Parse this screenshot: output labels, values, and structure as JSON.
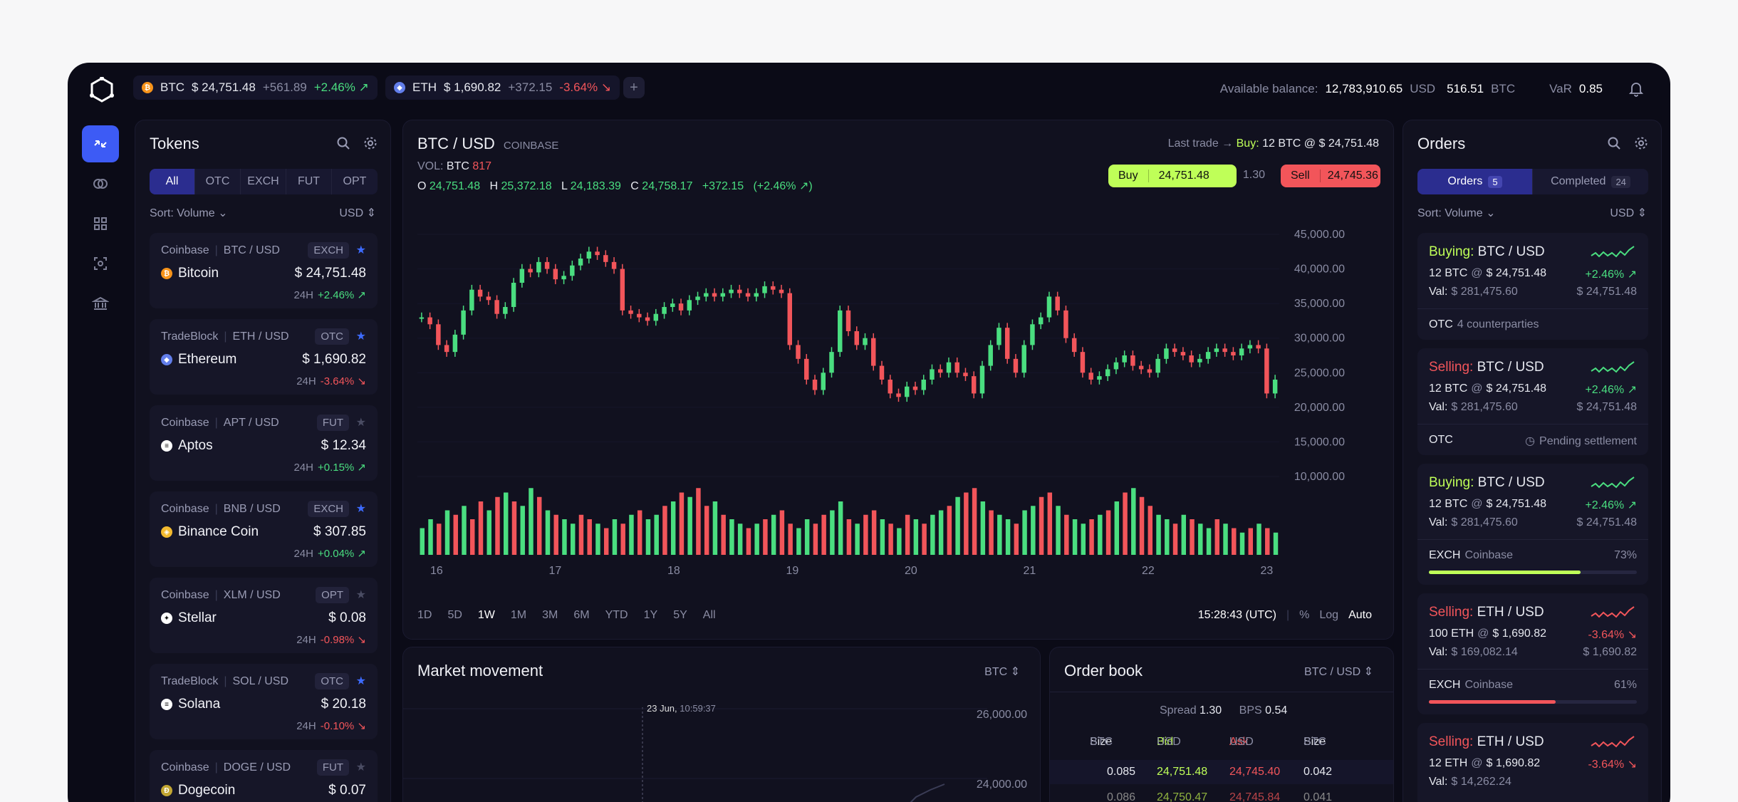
{
  "topbar": {
    "tickers": [
      {
        "symbol": "BTC",
        "price": "$ 24,751.48",
        "change_abs": "+561.89",
        "change_pct": "+2.46% ↗",
        "dir": "pos",
        "coin_color": "#f7931a"
      },
      {
        "symbol": "ETH",
        "price": "$ 1,690.82",
        "change_abs": "+372.15",
        "change_pct": "-3.64% ↘",
        "dir": "neg",
        "coin_color": "#627eea"
      }
    ],
    "add_tab": "+",
    "balance_label": "Available balance:",
    "balance_usd": "12,783,910.65",
    "balance_usd_unit": "USD",
    "balance_btc": "516.51",
    "balance_btc_unit": "BTC",
    "var_label": "VaR",
    "var_value": "0.85"
  },
  "tokens": {
    "title": "Tokens",
    "filters": [
      "All",
      "OTC",
      "EXCH",
      "FUT",
      "OPT"
    ],
    "active_filter": "All",
    "sort": "Sort: Volume",
    "currency": "USD",
    "items": [
      {
        "source": "Coinbase",
        "pair": "BTC / USD",
        "type": "EXCH",
        "starred": true,
        "name": "Bitcoin",
        "price": "$ 24,751.48",
        "period": "24H",
        "change": "+2.46% ↗",
        "dir": "pos",
        "icon": "bitcoin-icon",
        "icon_color": "#f7931a",
        "glyph": "₿"
      },
      {
        "source": "TradeBlock",
        "pair": "ETH / USD",
        "type": "OTC",
        "starred": true,
        "name": "Ethereum",
        "price": "$ 1,690.82",
        "period": "24H",
        "change": "-3.64% ↘",
        "dir": "neg",
        "icon": "ethereum-icon",
        "icon_color": "#627eea",
        "glyph": "◆"
      },
      {
        "source": "Coinbase",
        "pair": "APT / USD",
        "type": "FUT",
        "starred": false,
        "name": "Aptos",
        "price": "$ 12.34",
        "period": "24H",
        "change": "+0.15% ↗",
        "dir": "pos",
        "icon": "aptos-icon",
        "icon_color": "#ffffff",
        "glyph": "≡"
      },
      {
        "source": "Coinbase",
        "pair": "BNB / USD",
        "type": "EXCH",
        "starred": true,
        "name": "Binance Coin",
        "price": "$ 307.85",
        "period": "24H",
        "change": "+0.04% ↗",
        "dir": "pos",
        "icon": "binance-icon",
        "icon_color": "#f3ba2f",
        "glyph": "◈"
      },
      {
        "source": "Coinbase",
        "pair": "XLM / USD",
        "type": "OPT",
        "starred": false,
        "name": "Stellar",
        "price": "$ 0.08",
        "period": "24H",
        "change": "-0.98% ↘",
        "dir": "neg",
        "icon": "stellar-icon",
        "icon_color": "#ffffff",
        "glyph": "✦"
      },
      {
        "source": "TradeBlock",
        "pair": "SOL / USD",
        "type": "OTC",
        "starred": true,
        "name": "Solana",
        "price": "$ 20.18",
        "period": "24H",
        "change": "-0.10% ↘",
        "dir": "neg",
        "icon": "solana-icon",
        "icon_color": "#ffffff",
        "glyph": "≡"
      },
      {
        "source": "Coinbase",
        "pair": "DOGE / USD",
        "type": "FUT",
        "starred": false,
        "name": "Dogecoin",
        "price": "$ 0.07",
        "period": "24H",
        "change": "",
        "dir": "pos",
        "icon": "dogecoin-icon",
        "icon_color": "#c2a633",
        "glyph": "Ð"
      }
    ]
  },
  "chart": {
    "pair": "BTC / USD",
    "exchange": "COINBASE",
    "last_trade_label": "Last trade →",
    "last_trade_side": "Buy:",
    "last_trade_value": "12 BTC @ $ 24,751.48",
    "vol_label": "VOL:",
    "vol_unit": "BTC",
    "vol_value": "817",
    "o_label": "O",
    "o": "24,751.48",
    "h_label": "H",
    "h": "25,372.18",
    "l_label": "L",
    "l": "24,183.39",
    "c_label": "C",
    "c": "24,758.17",
    "chg": "+372.15",
    "chg_pct": "(+2.46% ↗)",
    "buy_label": "Buy",
    "buy_price": "24,751.48",
    "spread": "1.30",
    "sell_label": "Sell",
    "sell_price": "24,745.36",
    "timeframes": [
      "1D",
      "5D",
      "1W",
      "1M",
      "3M",
      "6M",
      "YTD",
      "1Y",
      "5Y",
      "All"
    ],
    "active_timeframe": "1W",
    "time": "15:28:43 (UTC)",
    "opts": [
      "%",
      "Log",
      "Auto"
    ],
    "active_opt": "Auto"
  },
  "chart_data": {
    "type": "candlestick",
    "x_ticks": [
      "16",
      "17",
      "18",
      "19",
      "20",
      "21",
      "22",
      "23"
    ],
    "y_ticks": [
      "45,000.00",
      "40,000.00",
      "35,000.00",
      "30,000.00",
      "25,000.00",
      "20,000.00",
      "15,000.00",
      "10,000.00"
    ],
    "ylim": [
      10000,
      45000
    ],
    "close": [
      33000,
      32000,
      29000,
      28000,
      30500,
      34000,
      37000,
      36000,
      35500,
      33500,
      34500,
      38000,
      40000,
      39500,
      41000,
      40000,
      38500,
      39000,
      40500,
      41500,
      42500,
      42000,
      41000,
      40000,
      34000,
      33500,
      33000,
      32500,
      33500,
      34500,
      35000,
      34000,
      35500,
      36000,
      36500,
      36000,
      36500,
      37000,
      36500,
      36000,
      36500,
      37500,
      37000,
      36500,
      29000,
      27000,
      24000,
      22500,
      25000,
      28000,
      34000,
      31000,
      29000,
      30000,
      26000,
      24000,
      22000,
      21500,
      23000,
      22500,
      24000,
      25500,
      25000,
      26500,
      25000,
      24500,
      22000,
      26000,
      29000,
      31500,
      27000,
      25000,
      29000,
      32000,
      33000,
      36000,
      34000,
      30000,
      28000,
      25000,
      24000,
      24500,
      25500,
      26500,
      27500,
      26000,
      25500,
      25000,
      27000,
      28500,
      28000,
      27500,
      26500,
      27000,
      28000,
      28500,
      28000,
      27500,
      28500,
      29000,
      28500,
      22000,
      24000
    ],
    "volume_up": [
      true,
      true,
      false,
      true,
      false,
      true,
      false,
      false,
      true,
      false,
      true,
      false,
      true,
      true,
      false,
      true,
      false,
      true,
      true,
      false,
      false,
      true,
      false,
      true,
      false,
      true,
      false,
      true,
      true,
      false,
      true,
      false,
      true,
      false,
      false,
      true,
      false,
      true,
      true,
      false,
      true,
      false,
      true,
      false,
      false,
      true,
      true,
      false,
      false,
      true,
      true,
      false,
      true,
      false,
      false,
      true,
      false,
      true,
      false,
      true,
      false,
      true,
      true,
      false,
      true,
      false,
      false,
      true,
      false,
      true,
      true,
      false,
      true,
      true,
      false,
      false,
      true,
      false,
      true,
      true,
      false,
      true,
      false,
      true,
      false,
      true,
      false,
      false,
      true,
      true,
      false,
      true,
      false,
      true,
      true,
      false,
      true,
      false,
      true,
      false,
      true,
      false,
      true
    ],
    "volume": [
      30,
      40,
      35,
      50,
      45,
      55,
      40,
      60,
      50,
      65,
      70,
      60,
      55,
      75,
      65,
      50,
      45,
      40,
      35,
      45,
      40,
      35,
      30,
      40,
      35,
      45,
      50,
      40,
      45,
      55,
      60,
      70,
      65,
      75,
      55,
      60,
      45,
      40,
      35,
      30,
      35,
      40,
      45,
      50,
      35,
      30,
      40,
      35,
      45,
      50,
      60,
      40,
      35,
      45,
      50,
      40,
      35,
      30,
      45,
      40,
      35,
      45,
      50,
      55,
      65,
      70,
      75,
      60,
      50,
      45,
      40,
      35,
      50,
      55,
      65,
      70,
      55,
      45,
      40,
      35,
      40,
      45,
      50,
      60,
      70,
      75,
      65,
      55,
      45,
      40,
      35,
      45,
      40,
      35,
      30,
      40,
      35,
      30,
      25,
      30,
      35,
      30,
      25
    ]
  },
  "market": {
    "title": "Market movement",
    "currency": "BTC",
    "marker_date": "23 Jun,",
    "marker_time": "10:59:37",
    "y_ticks": [
      "26,000.00",
      "24,000.00"
    ]
  },
  "orderbook": {
    "title": "Order book",
    "pair": "BTC / USD",
    "spread_label": "Spread",
    "spread": "1.30",
    "bps_label": "BPS",
    "bps": "0.54",
    "headers": [
      {
        "label": "Size",
        "unit": "BTC"
      },
      {
        "label": "Bid",
        "unit": "USD"
      },
      {
        "label": "Ask",
        "unit": "USD"
      },
      {
        "label": "Size",
        "unit": "BTC"
      }
    ],
    "rows": [
      [
        "0.085",
        "24,751.48",
        "24,745.40",
        "0.042"
      ],
      [
        "0.086",
        "24,750.47",
        "24,745.84",
        "0.041"
      ]
    ]
  },
  "orders": {
    "title": "Orders",
    "tabs": [
      {
        "label": "Orders",
        "count": "5"
      },
      {
        "label": "Completed",
        "count": "24"
      }
    ],
    "sort": "Sort: Volume",
    "currency": "USD",
    "items": [
      {
        "side": "Buying:",
        "pair": "BTC / USD",
        "qty": "12 BTC",
        "at": "@",
        "price": "$ 24,751.48",
        "change": "+2.46% ↗",
        "dir": "pos",
        "val_label": "Val:",
        "val": "$ 281,475.60",
        "val_price": "$ 24,751.48",
        "venue": "OTC",
        "venue_extra": "4 counterparties",
        "status": "",
        "progress": null
      },
      {
        "side": "Selling:",
        "pair": "BTC / USD",
        "qty": "12 BTC",
        "at": "@",
        "price": "$ 24,751.48",
        "change": "+2.46% ↗",
        "dir": "pos",
        "val_label": "Val:",
        "val": "$ 281,475.60",
        "val_price": "$ 24,751.48",
        "venue": "OTC",
        "venue_extra": "",
        "status": "Pending settlement",
        "progress": null
      },
      {
        "side": "Buying:",
        "pair": "BTC / USD",
        "qty": "12 BTC",
        "at": "@",
        "price": "$ 24,751.48",
        "change": "+2.46% ↗",
        "dir": "pos",
        "val_label": "Val:",
        "val": "$ 281,475.60",
        "val_price": "$ 24,751.48",
        "venue": "EXCH",
        "venue_extra": "Coinbase",
        "status": "73%",
        "progress": 0.73
      },
      {
        "side": "Selling:",
        "pair": "ETH / USD",
        "qty": "100 ETH",
        "at": "@",
        "price": "$ 1,690.82",
        "change": "-3.64% ↘",
        "dir": "neg",
        "val_label": "Val:",
        "val": "$ 169,082.14",
        "val_price": "$ 1,690.82",
        "venue": "EXCH",
        "venue_extra": "Coinbase",
        "status": "61%",
        "progress": 0.61
      },
      {
        "side": "Selling:",
        "pair": "ETH / USD",
        "qty": "12 ETH",
        "at": "@",
        "price": "$ 1,690.82",
        "change": "-3.64% ↘",
        "dir": "neg",
        "val_label": "Val:",
        "val": "$ 14,262.24",
        "val_price": "",
        "venue": "",
        "venue_extra": "",
        "status": "",
        "progress": null
      }
    ]
  },
  "colors": {
    "accent": "#3d5bf5",
    "buy": "#bfff58",
    "sell": "#f2555a",
    "up": "#4ade80",
    "down": "#f2555a"
  }
}
